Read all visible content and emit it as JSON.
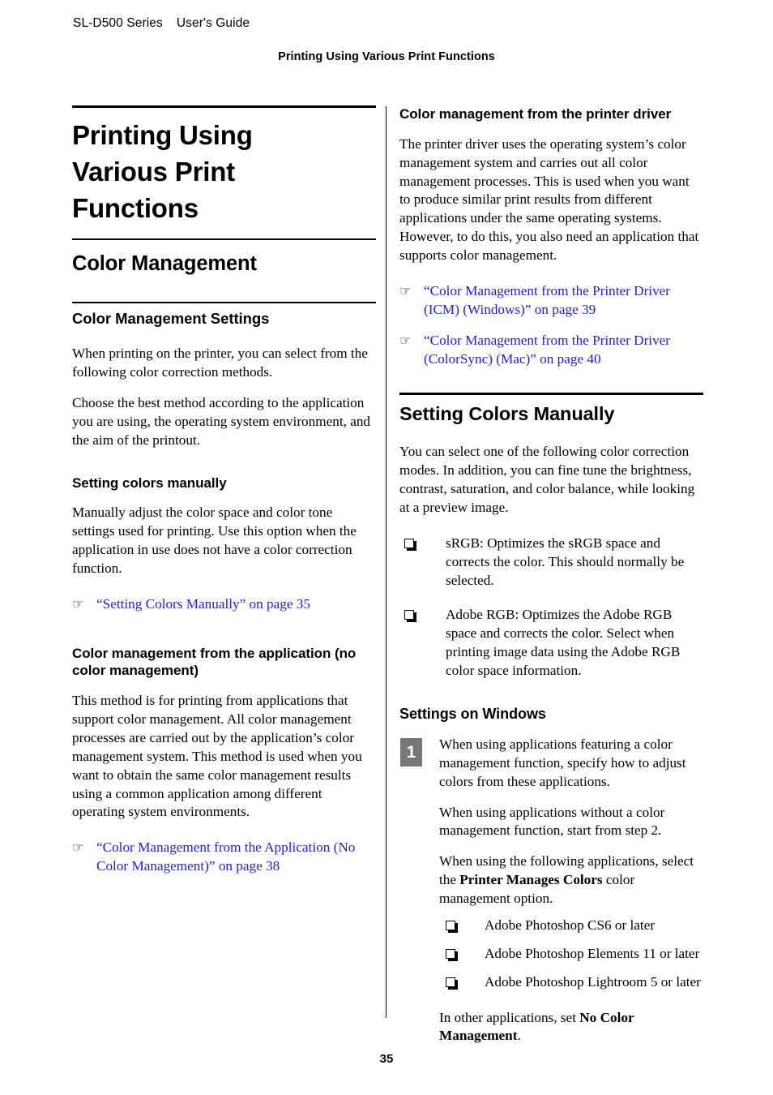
{
  "header": {
    "product": "SL-D500 Series",
    "guide": "User's Guide",
    "chapter": "Printing Using Various Print Functions"
  },
  "footer": {
    "page_number": "35"
  },
  "icons": {
    "xref": "☞",
    "bullet": "shadow-box-bullet"
  },
  "colors": {
    "link": "#2222cc",
    "step_box": "#767676",
    "rule": "#000000"
  },
  "left_column": {
    "title": "Printing Using Various Print Functions",
    "section": "Color Management",
    "subsection": "Color Management Settings",
    "intro_p1": "When printing on the printer, you can select from the following color correction methods.",
    "intro_p2": "Choose the best method according to the application you are using, the operating system environment, and the aim of the printout.",
    "sub_h1": "Setting colors manually",
    "sub_h1_p": "Manually adjust the color space and color tone settings used for printing. Use this option when the application in use does not have a color correction function.",
    "link1": "“Setting Colors Manually” on page 35",
    "sub_h2": "Color management from the application (no color management)",
    "sub_h2_p": "This method is for printing from applications that support color management. All color management processes are carried out by the application’s color management system. This method is used when you want to obtain the same color management results using a common application among different operating system environments.",
    "link2": "“Color Management from the Application (No Color Management)” on page 38"
  },
  "right_column": {
    "sub_h1": "Color management from the printer driver",
    "sub_h1_p": "The printer driver uses the operating system’s color management system and carries out all color management processes. This is used when you want to produce similar print results from different applications under the same operating systems. However, to do this, you also need an application that supports color management.",
    "link1": "“Color Management from the Printer Driver (ICM) (Windows)” on page 39",
    "link2": "“Color Management from the Printer Driver (ColorSync) (Mac)” on page 40",
    "section": "Setting Colors Manually",
    "section_p": "You can select one of the following color correction modes. In addition, you can fine tune the brightness, contrast, saturation, and color balance, while looking at a preview image.",
    "modes": [
      "sRGB: Optimizes the sRGB space and corrects the color. This should normally be selected.",
      "Adobe RGB: Optimizes the Adobe RGB space and corrects the color. Select when printing image data using the Adobe RGB color space information."
    ],
    "sub_h2": "Settings on Windows",
    "step1": {
      "number": "1",
      "p1": "When using applications featuring a color management function, specify how to adjust colors from these applications.",
      "p2": "When using applications without a color management function, start from step 2.",
      "p3_before": "When using the following applications, select the ",
      "p3_bold": "Printer Manages Colors",
      "p3_after": " color management option.",
      "apps": [
        "Adobe Photoshop CS6 or later",
        "Adobe Photoshop Elements 11 or later",
        "Adobe Photoshop Lightroom 5 or later"
      ],
      "p4_before": "In other applications, set ",
      "p4_bold": "No Color Management",
      "p4_after": "."
    }
  }
}
